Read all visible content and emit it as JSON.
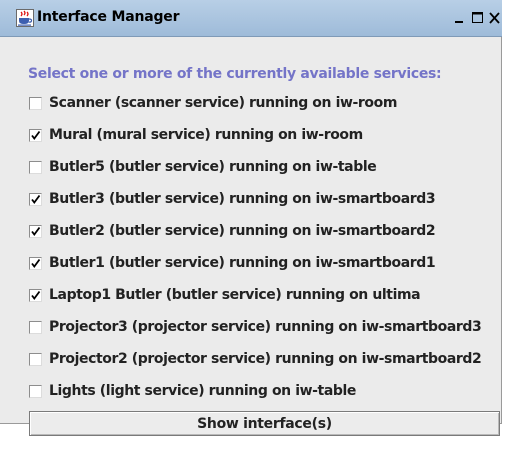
{
  "window": {
    "title": "Interface Manager",
    "title_bar_color": "#9ebbd9",
    "prompt_color": "#7474c8"
  },
  "prompt": "Select one or more of the currently available services:",
  "services": [
    {
      "label": "Scanner (scanner service) running on iw-room",
      "checked": false
    },
    {
      "label": "Mural (mural service) running on iw-room",
      "checked": true
    },
    {
      "label": "Butler5 (butler service) running on iw-table",
      "checked": false
    },
    {
      "label": "Butler3 (butler service) running on iw-smartboard3",
      "checked": true
    },
    {
      "label": "Butler2 (butler service) running on iw-smartboard2",
      "checked": true
    },
    {
      "label": "Butler1 (butler service) running on iw-smartboard1",
      "checked": true
    },
    {
      "label": "Laptop1 Butler (butler service) running on ultima",
      "checked": true
    },
    {
      "label": "Projector3 (projector service) running on iw-smartboard3",
      "checked": false
    },
    {
      "label": "Projector2 (projector service) running on iw-smartboard2",
      "checked": false
    },
    {
      "label": "Lights (light service) running on iw-table",
      "checked": false
    }
  ],
  "show_button": {
    "label": "Show interface(s)"
  },
  "icons": {
    "app": "java-coffee-cup-icon",
    "minimize": "minimize-icon",
    "maximize": "maximize-icon",
    "close": "close-icon"
  }
}
